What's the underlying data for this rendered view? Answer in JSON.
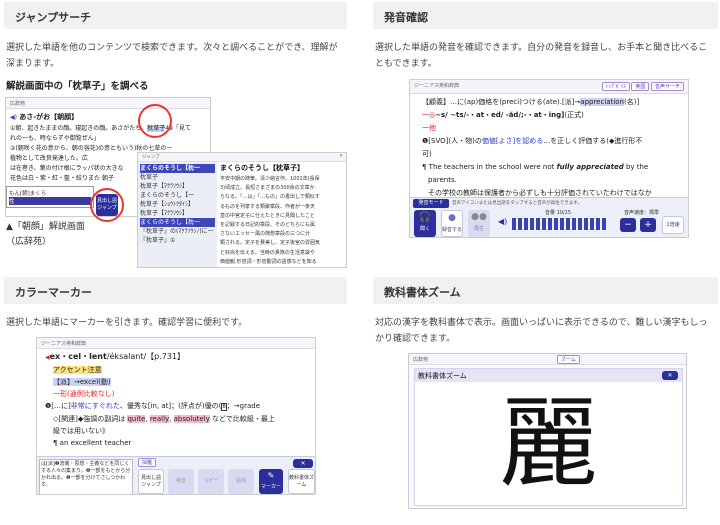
{
  "sections": {
    "jump": {
      "title": "ジャンプサーチ",
      "desc1": "選択した単語を他のコンテンツで検索できます。次々と調べることができ、理解が",
      "desc2": "深まります。",
      "subtitle": "解説画面中の「枕草子」を調べる",
      "caption1": "▲「朝顔」解説画面",
      "caption2": "（広辞苑）"
    },
    "pron": {
      "title": "発音確認",
      "desc1": "選択した単語の発音を確認できます。自分の発音を録音し、お手本と聞き比べるこ",
      "desc2": "ともできます。"
    },
    "marker": {
      "title": "カラーマーカー",
      "desc1": "選択した単語にマーカーを引きます。確認学習に便利です。"
    },
    "zoom": {
      "title": "教科書体ズーム",
      "desc1": "対応の漢字を教科書体で表示。画面いっぱいに表示できるので、難しい漢字もしっ",
      "desc2": "かり確認できます。"
    }
  },
  "shot1": {
    "toolbar": "広辞苑",
    "headword": "あさ‐がお【朝顔】",
    "line1": "①朝、起きたままの顔。寝起きの顔。あさがたち。",
    "line1b": "枕草子",
    "line1c": "49「見て",
    "line2": "れの一も、時ならずや御覧ぜん」",
    "line3": "②(朝咲く花の意から、朝の容花)の意ともいう)秋の七草の一",
    "line4": "植物として改良発達した。広",
    "line5": "は在巻き、葉の付け根にラッパ状の大きな",
    "line6": "花色は白・紫・紅・藍・絞りまた",
    "line6b": "朝子",
    "side_box": "もん[朝]まくら",
    "side_box2": "性",
    "jump_btn": "見出し語ジャンプ",
    "popup_tool": "ジャンプ",
    "popup_head": "まくらのそうし【枕草子】",
    "list": [
      "まくらのそうし【枕一",
      "枕草子",
      "枕草子【ﾏｸﾗｿｳｼ】",
      "まくらのそうし【一",
      "枕草子【ｼｮｳﾄｸﾀｲｼ】",
      "枕草子【ﾏｸﾗｿｳｼ】",
      "まくらのそうし【枕一",
      "『枕草子』の(ﾏｸﾗｿｳｼﾉ)に一",
      "『枕草子』①"
    ],
    "detail": [
      "平安中期の随筆。清少納言作。1001年(長保",
      "3)頃成立。長短さまざまの300余の文章か",
      "らなる。「…は」「…もの」の書出しで類似す",
      "るものを列挙する類聚章段、作者が一条天",
      "皇の中宮定子に仕えたときに見聞したこと",
      "を記録する日記的章段、そのどちらにも属",
      "さないエッセー風の随想章段の三つに分",
      "類される。定子を賛美し、定子後宮の雰囲気",
      "と好尚を伝える。当時の貴族の生活意識や",
      "価値観,形容詞・形容動詞の語感などを知る"
    ]
  },
  "shot2": {
    "toolbar": "ジーニアス英和辞典",
    "pill1": "ﾄｯﾌﾟﾎﾞｲｽ",
    "pill2": "英国",
    "pill3": "音声サーチ",
    "l1a": "【顧義】…に(ap)価格を(preci)つける(ate).[派]→",
    "l1b": "appreciation",
    "l1c": "(名)]",
    "l2": "~s/ ~ts/-・at・ed/ -ăd/;-・at・ing]",
    "l2b": "(正式)",
    "l3": "一他",
    "l4a": "❶[SVO](人・物)の",
    "l4b": "価値[よさ]を認める",
    "l4c": "…を正しく評価する(◆進行形不",
    "l5": "可)",
    "l6a": "¶ The teachers in the school were not ",
    "l6b": "fully appreciated",
    "l6c": " by the",
    "l7": "parents.",
    "l8": "その学校の教師は保護者から必ずしも十分評価されていたわけではなか",
    "mode_label": "発音モード",
    "mode_hint": "音声アイコンまたは見出語をタップすると音声が再生できます。",
    "btn_listen": "聞く",
    "btn_rec": "録音する",
    "btn_play": "再生",
    "vol_label": "音量 10/15",
    "speed_label": "音声速度：標準",
    "minus": "−",
    "plus": "+",
    "ratio": "1倍速"
  },
  "shot3": {
    "toolbar": "ジーニアス英和辞典",
    "headword": "ex・cel・lent",
    "pron": "/éksalant/【p.731】",
    "accent": "アクセント注意",
    "deriv": "【派】→excel(動)",
    "use": "一形(通例比較なし)",
    "m1a": "❶[…に]",
    "m1b": "非常にすぐれた",
    "m1c": "、優秀な[in, at]；(評点が)優の(",
    "m1d": "B",
    "m1e": "；→grade",
    "m2a": "◇[関連]◆強調の副詞は ",
    "w1": "quite",
    "w2": "really",
    "w3": "absolutely",
    "m2b": " などで比較級・最上",
    "m3": "級では用いない》",
    "ex": "¶ an excellent teacher",
    "note": "は[派]❶流儀・思想・主義などを同じくする人々の集まり。❷一部をもとから分かれ出る。❷一部を分けてさしつかわす。",
    "tab": "採鑑",
    "b1": "見出し語ジャンプ",
    "b2": "発音",
    "b3": "コピー",
    "b4": "追加",
    "b5": "マーカー",
    "b6": "教科書体ズーム"
  },
  "shot4": {
    "toolbar": "広辞苑",
    "pill": "ズーム",
    "title": "教科書体ズーム",
    "kanji": "麗",
    "close": "✕"
  }
}
